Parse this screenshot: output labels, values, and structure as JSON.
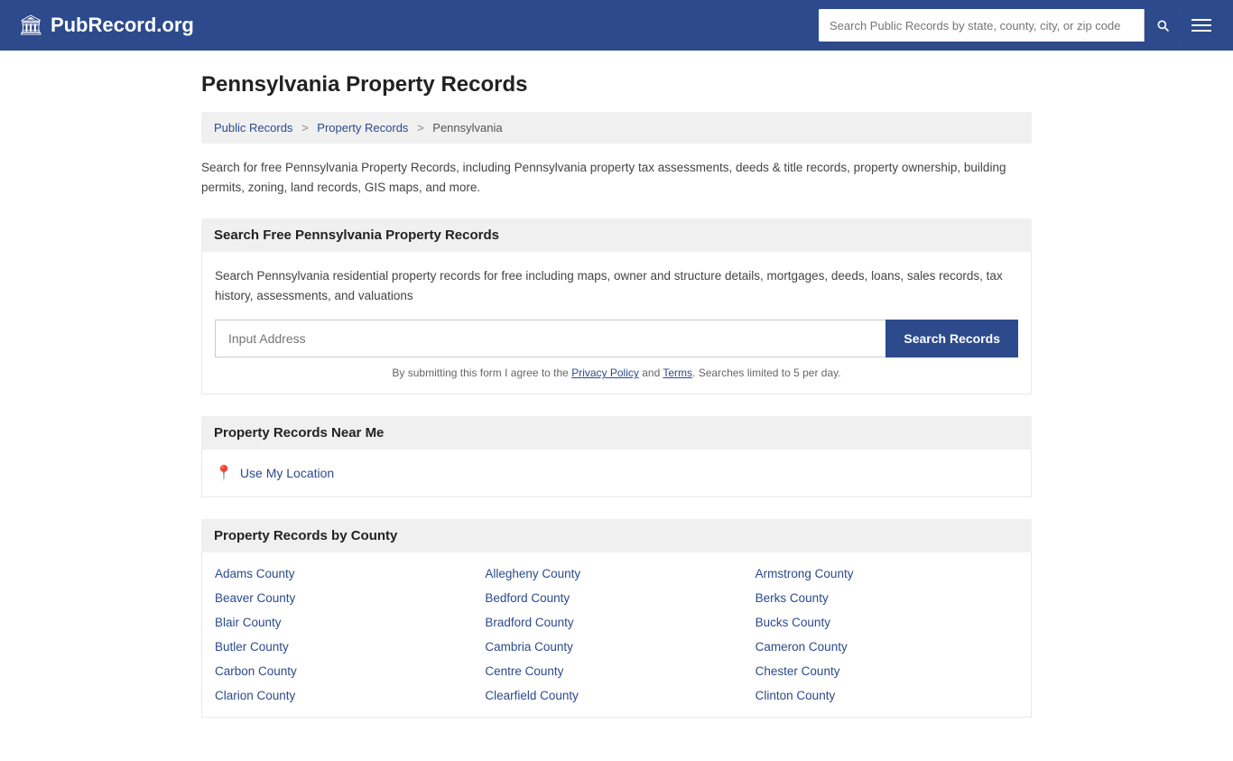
{
  "header": {
    "logo_icon": "🏛",
    "logo_text": "PubRecord.org",
    "search_placeholder": "Search Public Records by state, county, city, or zip code"
  },
  "page": {
    "title": "Pennsylvania Property Records",
    "breadcrumb": {
      "items": [
        "Public Records",
        "Property Records",
        "Pennsylvania"
      ]
    },
    "description": "Search for free Pennsylvania Property Records, including Pennsylvania property tax assessments, deeds & title records, property ownership, building permits, zoning, land records, GIS maps, and more.",
    "search_section": {
      "heading": "Search Free Pennsylvania Property Records",
      "description": "Search Pennsylvania residential property records for free including maps, owner and structure details, mortgages, deeds, loans, sales records, tax history, assessments, and valuations",
      "input_placeholder": "Input Address",
      "button_label": "Search Records",
      "disclaimer": "By submitting this form I agree to the",
      "privacy_policy_label": "Privacy Policy",
      "and_text": "and",
      "terms_label": "Terms",
      "limit_text": ". Searches limited to 5 per day."
    },
    "near_me_section": {
      "heading": "Property Records Near Me",
      "use_location_label": "Use My Location"
    },
    "county_section": {
      "heading": "Property Records by County",
      "counties": [
        "Adams County",
        "Allegheny County",
        "Armstrong County",
        "Beaver County",
        "Bedford County",
        "Berks County",
        "Blair County",
        "Bradford County",
        "Bucks County",
        "Butler County",
        "Cambria County",
        "Cameron County",
        "Carbon County",
        "Centre County",
        "Chester County",
        "Clarion County",
        "Clearfield County",
        "Clinton County"
      ]
    }
  }
}
